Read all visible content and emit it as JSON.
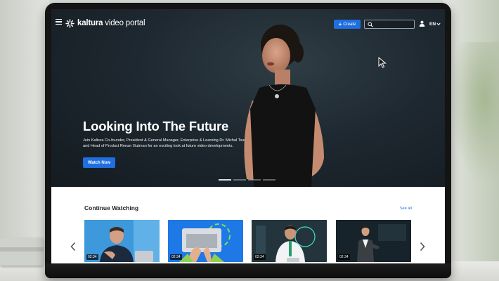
{
  "brand": {
    "name_bold": "kaltura",
    "name_light": " video portal",
    "accent": "#1f6fe0"
  },
  "navbar": {
    "menu_icon": "hamburger-icon",
    "create_label": "Create",
    "search_placeholder": "",
    "user_icon": "user-icon",
    "language": "EN"
  },
  "hero": {
    "title": "Looking Into The Future",
    "description": "Join Kaltura Co-founder, President & General Manager, Enterprise & Learning Dr. Michal Tsur and Head of Product Renan Gutman for an exciting look at future video developments.",
    "cta_label": "Watch Now",
    "slide_count": 4,
    "active_slide": 1
  },
  "continue_watching": {
    "title": "Continue Watching",
    "see_all_label": "See all",
    "items": [
      {
        "duration": "02:34"
      },
      {
        "duration": "02:34"
      },
      {
        "duration": "02:34"
      },
      {
        "duration": "02:34"
      }
    ]
  }
}
